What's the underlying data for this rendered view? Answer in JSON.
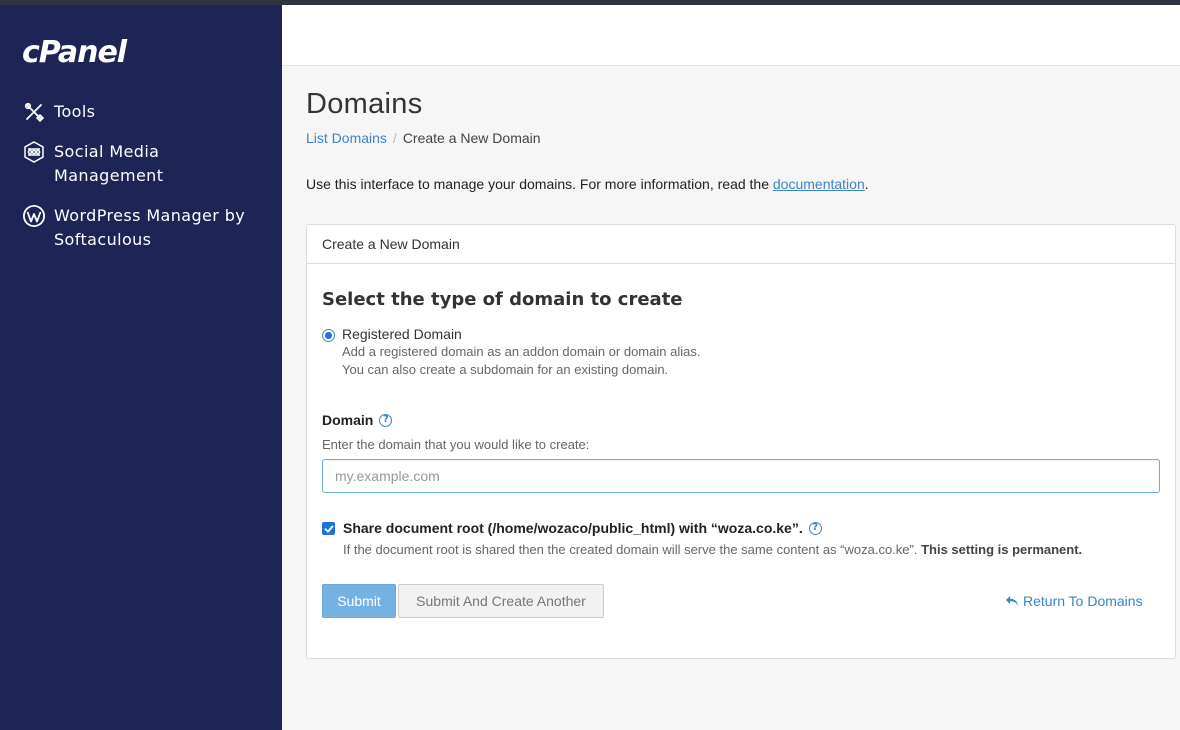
{
  "sidebar": {
    "logo": "cPanel",
    "items": [
      {
        "label": "Tools",
        "icon": "tools-icon"
      },
      {
        "label": "Social Media Management",
        "icon": "social-media-icon"
      },
      {
        "label": "WordPress Manager by Softaculous",
        "icon": "wordpress-icon"
      }
    ]
  },
  "page": {
    "title": "Domains",
    "breadcrumb": {
      "link": "List Domains",
      "separator": "/",
      "current": "Create a New Domain"
    },
    "intro": {
      "text": "Use this interface to manage your domains. For more information, read the ",
      "link": "documentation",
      "end": "."
    }
  },
  "panel": {
    "heading": "Create a New Domain",
    "section_title": "Select the type of domain to create",
    "radio": {
      "label": "Registered Domain",
      "desc_line1": "Add a registered domain as an addon domain or domain alias.",
      "desc_line2": "You can also create a subdomain for an existing domain.",
      "selected": true
    },
    "domain_field": {
      "label": "Domain",
      "help": "Enter the domain that you would like to create:",
      "value": "",
      "placeholder": "my.example.com"
    },
    "share_root": {
      "checked": true,
      "label": "Share document root (/home/wozaco/public_html) with “woza.co.ke”.",
      "desc": "If the document root is shared then the created domain will serve the same content as “woza.co.ke”. ",
      "desc_bold": "This setting is permanent."
    },
    "buttons": {
      "submit": "Submit",
      "submit_another": "Submit And Create Another",
      "return": "Return To Domains"
    }
  },
  "colors": {
    "sidebar_bg": "#1f2456",
    "link": "#3a86c8",
    "accent": "#1e74d6",
    "submit_bg": "#76b1e3"
  }
}
